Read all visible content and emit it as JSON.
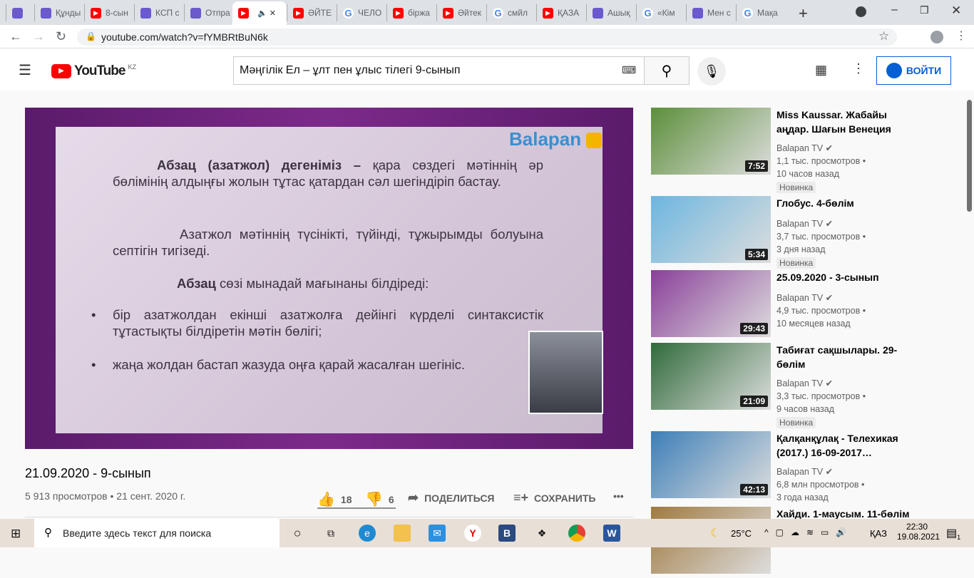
{
  "tabs": [
    {
      "label": "",
      "icon": "app-icon"
    },
    {
      "label": "Құнды",
      "icon": "map-pin-icon"
    },
    {
      "label": "8-сын",
      "icon": "youtube-icon"
    },
    {
      "label": "КСП с",
      "icon": "app-icon"
    },
    {
      "label": "Отпра",
      "icon": "mail-icon"
    },
    {
      "label": "",
      "icon": "youtube-icon",
      "active": true
    },
    {
      "label": "ӘЙТЕ",
      "icon": "youtube-icon"
    },
    {
      "label": "ЧЕЛО",
      "icon": "google-icon"
    },
    {
      "label": "біржа",
      "icon": "youtube-icon"
    },
    {
      "label": "Әйтек",
      "icon": "youtube-icon"
    },
    {
      "label": "смйл",
      "icon": "google-icon"
    },
    {
      "label": "ҚАЗА",
      "icon": "youtube-icon"
    },
    {
      "label": "Ашық",
      "icon": "app-icon"
    },
    {
      "label": "«Кім",
      "icon": "google-icon"
    },
    {
      "label": "Мен с",
      "icon": "app-icon"
    },
    {
      "label": "Мақа",
      "icon": "google-icon"
    }
  ],
  "browser": {
    "url": "youtube.com/watch?v=fYMBRtBuN6k"
  },
  "youtube": {
    "logo": "YouTube",
    "region": "KZ",
    "search_value": "Мәңгілік Ел – ұлт пен ұлыс тілегі 9-сынып",
    "login": "ВОЙТИ"
  },
  "slide": {
    "brand": "Balapan",
    "p1_bold": "Абзац (азатжол) дегеніміз –",
    "p1": " қара сөздегі мәтіннің әр бөлімінің алдыңғы жолын тұтас қатардан сәл шегіндіріп бастау.",
    "p2": "Азатжол мәтіннің түсінікті, түйінді, тұжырымды болуына септігін тигізеді.",
    "p3_bold": "Абзац",
    "p3": " сөзі мынадай мағынаны білдіреді:",
    "b1": "бір азатжолдан екінші азатжолға дейінгі күрделі синтаксистік тұтастықты білдіретін мәтін бөлігі;",
    "b2": "жаңа жолдан бастап жазуда оңға қарай жасалған шегініс."
  },
  "video": {
    "title": "21.09.2020 - 9-сынып",
    "meta": "5 913 просмотров • 21 сент. 2020 г.",
    "likes": "18",
    "dislikes": "6",
    "share": "ПОДЕЛИТЬСЯ",
    "save": "СОХРАНИТЬ"
  },
  "related": [
    {
      "title": "Miss Kaussar. Жабайы аңдар. Шағын Венеция",
      "channel": "Balapan TV",
      "views": "1,1 тыс. просмотров •",
      "age": "10 часов назад",
      "badge": "Новинка",
      "duration": "7:52",
      "color": "#5c8f3a"
    },
    {
      "title": "Глобус. 4-бөлім",
      "channel": "Balapan TV",
      "views": "3,7 тыс. просмотров •",
      "age": "3 дня назад",
      "badge": "Новинка",
      "duration": "5:34",
      "color": "#6cb6e0"
    },
    {
      "title": "25.09.2020 - 3-сынып",
      "channel": "Balapan TV",
      "views": "4,9 тыс. просмотров •",
      "age": "10 месяцев назад",
      "duration": "29:43",
      "color": "#8a3f9a"
    },
    {
      "title": "Табиғат сақшылары. 29-бөлім",
      "channel": "Balapan TV",
      "views": "3,3 тыс. просмотров •",
      "age": "9 часов назад",
      "badge": "Новинка",
      "duration": "21:09",
      "color": "#2f6b3a"
    },
    {
      "title": "Қалқанқұлақ - Телехикая (2017.) 16-09-2017…",
      "channel": "Balapan TV",
      "views": "6,8 млн просмотров •",
      "age": "3 года назад",
      "duration": "42:13",
      "color": "#3c7fb8"
    },
    {
      "title": "Хайди. 1-маусым. 11-бөлім",
      "color": "#a07a40"
    }
  ],
  "taskbar": {
    "search_placeholder": "Введите здесь текст для поиска",
    "temp": "25°C",
    "lang": "ҚАЗ",
    "time": "22:30",
    "date": "19.08.2021",
    "notif": "1"
  }
}
